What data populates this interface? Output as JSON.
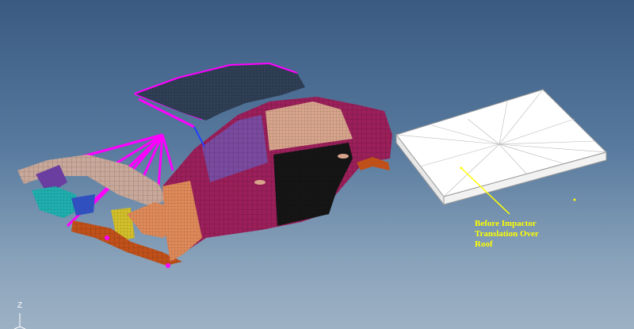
{
  "viewport": {
    "annotation_text": "Before Impactor\nTranslation Over\nRoof",
    "annotation_color": "#ffff00",
    "triad_axis_label": "Z",
    "background_top": "#3a5a82",
    "background_bottom": "#9db1c4"
  },
  "model_colors": {
    "body": "#9a1f5a",
    "roof": "#2f3f55",
    "rear_glass": "#7a4aa0",
    "rear_door": "#151515",
    "front_door": "#d8a58c",
    "front_fender": "#e08a5a",
    "rigid_links": "#ff00ff",
    "impactor": "#ffffff",
    "bumper_parts": "#c0501a",
    "suspension": "#d4c02a",
    "cyan_parts": "#20b0b0",
    "rails": "#c8a89a"
  },
  "icons": [
    "coordinate-triad-icon"
  ]
}
